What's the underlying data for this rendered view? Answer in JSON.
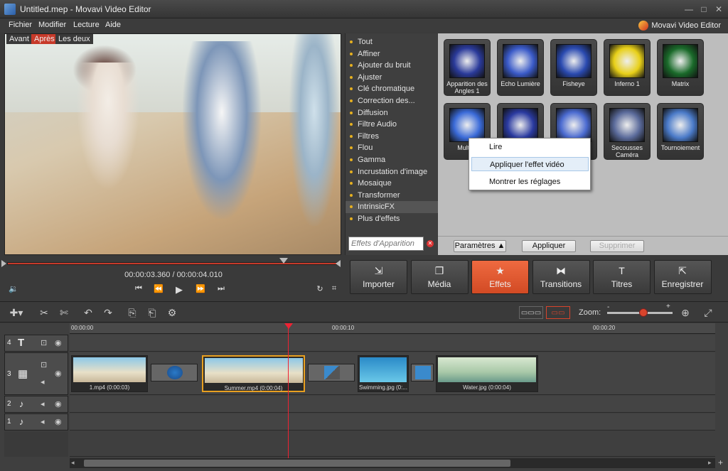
{
  "window": {
    "title": "Untitled.mep - Movavi Video Editor",
    "minimize": "—",
    "maximize": "□",
    "close": "✕"
  },
  "menu": {
    "items": [
      "Fichier",
      "Modifier",
      "Lecture",
      "Aide"
    ],
    "brand": "Movavi Video Editor"
  },
  "preview": {
    "tabs": [
      "Avant",
      "Après",
      "Les deux"
    ],
    "active_tab": "Après"
  },
  "effects": {
    "items": [
      "Tout",
      "Affiner",
      "Ajouter du bruit",
      "Ajuster",
      "Clé chromatique",
      "Correction des...",
      "Diffusion",
      "Filtre Audio",
      "Filtres",
      "Flou",
      "Gamma",
      "Incrustation d'image",
      "Mosaique",
      "Transformer",
      "IntrinsicFX",
      "Plus d'effets"
    ],
    "selected": "IntrinsicFX",
    "search_placeholder": "Effets d'Apparition"
  },
  "thumbnails": [
    {
      "label": "Apparition des Angles 1",
      "color": "#2a3a9a"
    },
    {
      "label": "Echo Lumière",
      "color": "#3a5ac8"
    },
    {
      "label": "Fisheye",
      "color": "#2a4ab0"
    },
    {
      "label": "Inferno 1",
      "color": "#e8d018"
    },
    {
      "label": "Matrix",
      "color": "#1a6a2a"
    },
    {
      "label": "Multi-Ir",
      "color": "#3a6ad8"
    },
    {
      "label": "",
      "color": "#2a3aa0"
    },
    {
      "label": "",
      "color": "#4a6ad0"
    },
    {
      "label": "Secousses Caméra",
      "color": "#5a6a9a"
    },
    {
      "label": "Tournoiement",
      "color": "#4a7ac8"
    }
  ],
  "context_menu": {
    "items": [
      "Lire",
      "Appliquer l'effet vidéo",
      "Montrer les réglages"
    ],
    "highlighted": "Appliquer l'effet vidéo"
  },
  "thumb_buttons": {
    "params": "Paramètres ▲",
    "apply": "Appliquer",
    "delete": "Supprimer"
  },
  "player": {
    "current": "00:00:03.360",
    "separator": "/",
    "total": "00:00:04.010",
    "progress": 1.0
  },
  "modes": [
    {
      "label": "Importer",
      "icon": "⇲"
    },
    {
      "label": "Média",
      "icon": "❐"
    },
    {
      "label": "Effets",
      "icon": "★"
    },
    {
      "label": "Transitions",
      "icon": "⧓"
    },
    {
      "label": "Titres",
      "icon": "T"
    },
    {
      "label": "Enregistrer",
      "icon": "⇱"
    }
  ],
  "active_mode": "Effets",
  "zoom": {
    "label": "Zoom:",
    "minus": "-",
    "plus": "+",
    "level": 0.55
  },
  "ruler": [
    "00:00:00",
    "00:00:10",
    "00:00:20"
  ],
  "tracks": [
    {
      "num": "4",
      "type": "T"
    },
    {
      "num": "3",
      "type": "▦"
    },
    {
      "num": "2",
      "type": "♪"
    },
    {
      "num": "1",
      "type": "♪"
    }
  ],
  "clips": [
    {
      "label": "1.mp4 (0:00:03)"
    },
    {
      "label": "Summer.mp4 (0:00:04)"
    },
    {
      "label": "Swimming.jpg (0:..."
    },
    {
      "label": "Water.jpg (0:00:04)"
    }
  ]
}
